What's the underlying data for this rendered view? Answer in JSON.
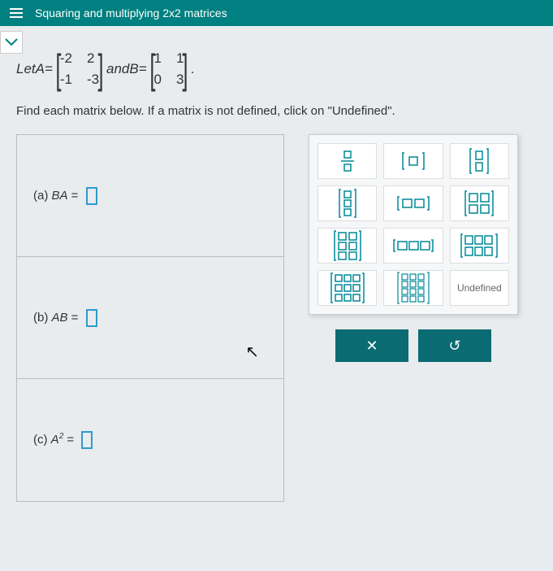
{
  "header": {
    "title": "Squaring and multiplying 2x2 matrices"
  },
  "definition": {
    "let": "Let ",
    "A_label": "A",
    "eq": " = ",
    "and": " and ",
    "B_label": "B",
    "period": ".",
    "A": {
      "r0c0": "-2",
      "r0c1": "2",
      "r1c0": "-1",
      "r1c1": "-3"
    },
    "B": {
      "r0c0": "1",
      "r0c1": "1",
      "r1c0": "0",
      "r1c1": "3"
    }
  },
  "instruction": "Find each matrix below. If a matrix is not defined, click on \"Undefined\".",
  "parts": {
    "a": {
      "label": "(a)  ",
      "expr": "BA",
      "eq": " = "
    },
    "b": {
      "label": "(b)  ",
      "expr": "AB",
      "eq": " = "
    },
    "c": {
      "label": "(c)  ",
      "expr": "A",
      "sup": "2",
      "eq": " = "
    }
  },
  "palette": {
    "undefined_label": "Undefined"
  },
  "actions": {
    "clear": "✕",
    "reset": "↺"
  }
}
